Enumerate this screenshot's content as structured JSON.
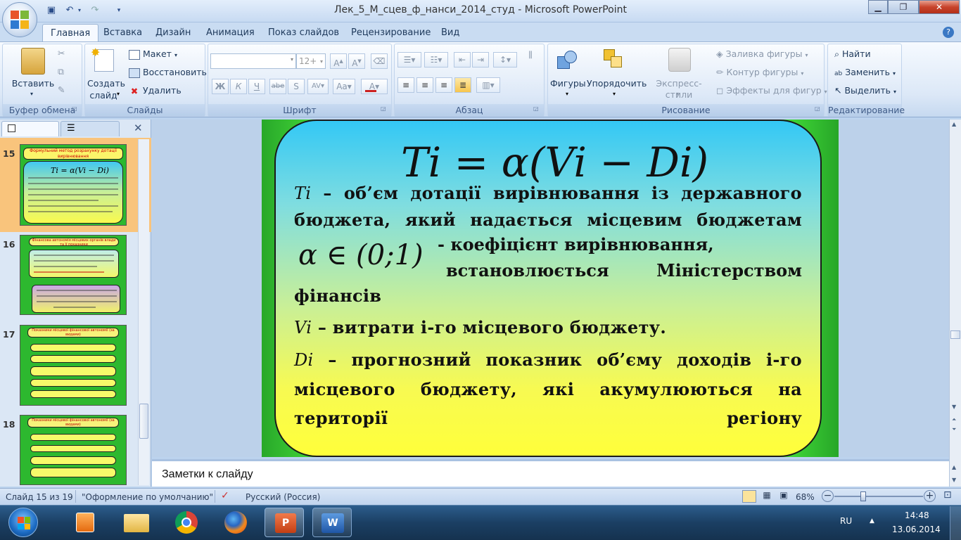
{
  "window": {
    "title": "Лек_5_М_сцев_ф_нанси_2014_студ - Microsoft PowerPoint"
  },
  "tabs": [
    "Главная",
    "Вставка",
    "Дизайн",
    "Анимация",
    "Показ слайдов",
    "Рецензирование",
    "Вид"
  ],
  "ribbon": {
    "clipboard": {
      "paste": "Вставить",
      "label": "Буфер обмена"
    },
    "slides": {
      "new_slide_1": "Создать",
      "new_slide_2": "слайд",
      "layout": "Макет",
      "reset": "Восстановить",
      "delete": "Удалить",
      "label": "Слайды"
    },
    "font": {
      "size": "12+",
      "label": "Шрифт"
    },
    "paragraph": {
      "label": "Абзац"
    },
    "drawing": {
      "shapes": "Фигуры",
      "arrange": "Упорядочить",
      "quick_styles": "Экспресс-стили",
      "fill": "Заливка фигуры",
      "outline": "Контур фигуры",
      "effects": "Эффекты для фигур",
      "label": "Рисование"
    },
    "editing": {
      "find": "Найти",
      "replace": "Заменить",
      "select": "Выделить",
      "label": "Редактирование"
    }
  },
  "thumbnails": [
    {
      "num": "15",
      "title": "Формульний метод розрахунку дотації вирівнювання",
      "formula": "Ti = α(Vi − Di)"
    },
    {
      "num": "16",
      "title": "Фінансова автономія місцевих органів влади та її показники"
    },
    {
      "num": "17",
      "title": "Показники місцевої фінансової автономії (за видами)"
    },
    {
      "num": "18",
      "title": "Показники місцевої фінансової автономії (за видами)"
    }
  ],
  "slide": {
    "formula": "Ti = α(Vi − Di)",
    "p1_var": "Ti",
    "p1_text": " – об’єм дотації вирівнювання із державного бюджета, який надається місцевим бюджетам",
    "alpha": "α ∈ (0;1)",
    "p2_a": "- коефіцієнт вирівнювання,",
    "p2_b": "встановлюється Міністерством",
    "p2_c": "фінансів",
    "p3_var": "Vi",
    "p3_text": " – витрати і-го місцевого бюджету.",
    "p4_var": "Di",
    "p4_text": " – прогнозний показник об’єму доходів і-го місцевого бюджету, які акумулюються на території регіону"
  },
  "notes": {
    "placeholder": "Заметки к слайду"
  },
  "status": {
    "slide_info": "Слайд 15 из 19",
    "theme": "\"Оформление по умолчанию\"",
    "language": "Русский (Россия)",
    "zoom": "68%",
    "zoom_level": 0.68
  },
  "taskbar": {
    "lang": "RU",
    "time": "14:48",
    "date": "13.06.2014"
  }
}
